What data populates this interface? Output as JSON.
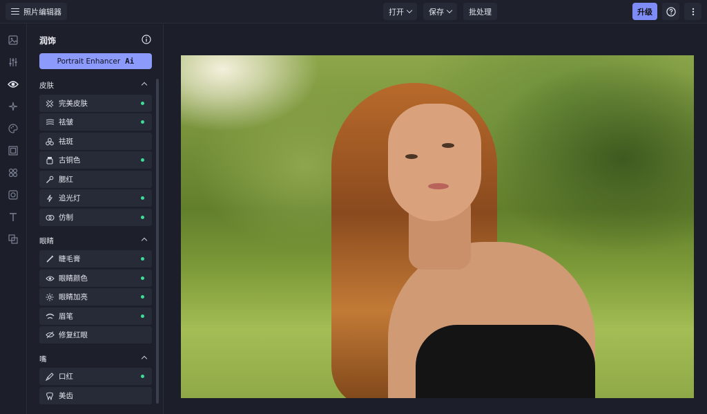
{
  "topbar": {
    "app_title": "照片编辑器",
    "open_label": "打开",
    "save_label": "保存",
    "batch_label": "批处理",
    "upgrade_label": "升级"
  },
  "panel": {
    "title": "润饰",
    "enhancer_label": "Portrait Enhancer",
    "enhancer_ai": "Ai",
    "sections": [
      {
        "title": "皮肤",
        "items": [
          {
            "label": "完美皮肤",
            "icon": "skin-smooth-icon",
            "dot": true
          },
          {
            "label": "祛皱",
            "icon": "wrinkle-icon",
            "dot": true
          },
          {
            "label": "祛斑",
            "icon": "blemish-icon",
            "dot": false
          },
          {
            "label": "古铜色",
            "icon": "bronze-jar-icon",
            "dot": true
          },
          {
            "label": "腮红",
            "icon": "blush-brush-icon",
            "dot": false
          },
          {
            "label": "追光灯",
            "icon": "lightning-icon",
            "dot": true
          },
          {
            "label": "仿制",
            "icon": "clone-icon",
            "dot": true
          }
        ]
      },
      {
        "title": "眼睛",
        "items": [
          {
            "label": "睫毛膏",
            "icon": "mascara-icon",
            "dot": true
          },
          {
            "label": "眼睛颜色",
            "icon": "eye-color-icon",
            "dot": true
          },
          {
            "label": "眼睛加亮",
            "icon": "eye-brighten-icon",
            "dot": true
          },
          {
            "label": "眉笔",
            "icon": "eyebrow-icon",
            "dot": true
          },
          {
            "label": "修复红眼",
            "icon": "red-eye-icon",
            "dot": false
          }
        ]
      },
      {
        "title": "嘴",
        "items": [
          {
            "label": "口红",
            "icon": "lipstick-icon",
            "dot": true
          },
          {
            "label": "美齿",
            "icon": "tooth-icon",
            "dot": false
          }
        ]
      }
    ]
  },
  "colors": {
    "accent": "#8c9afb",
    "upgrade": "#7d8cf7",
    "dot": "#3ddc97",
    "background": "#1c1f2a"
  }
}
